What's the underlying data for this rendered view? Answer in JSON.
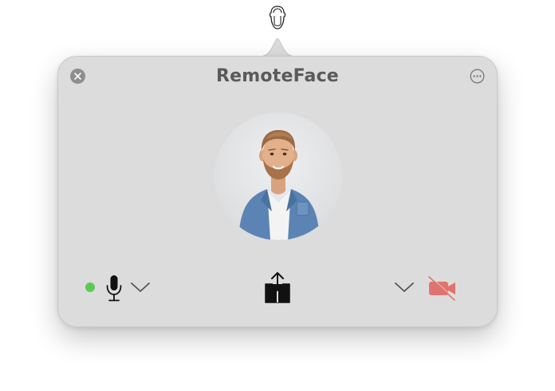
{
  "app": {
    "title": "RemoteFace"
  },
  "menubar": {
    "icon": "face-outline-icon"
  },
  "window_controls": {
    "close_icon": "close-icon",
    "more_icon": "ellipsis-circle-icon"
  },
  "controls": {
    "status": "connected",
    "status_color": "#5cc957",
    "microphone_icon": "microphone-icon",
    "microphone_menu_icon": "chevron-down-icon",
    "share_icon": "share-icon",
    "camera_menu_icon": "chevron-down-icon",
    "camera_icon": "video-off-icon",
    "camera_off_color": "#e0736f"
  },
  "colors": {
    "popover_background": "#dcdcdc",
    "title_color": "#5a5a5a",
    "close_button": "#8e8e8e"
  }
}
